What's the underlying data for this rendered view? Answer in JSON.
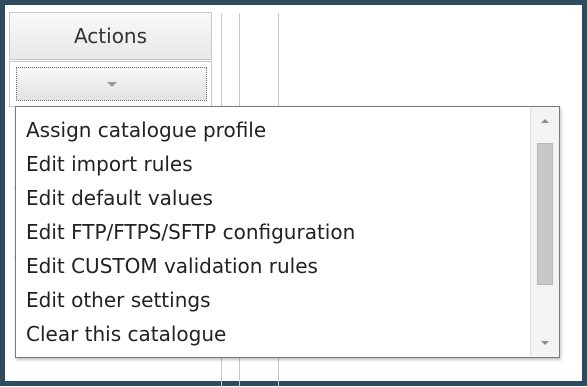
{
  "table": {
    "header_label": "Actions"
  },
  "actions_select": {
    "selected_value": "",
    "options": [
      {
        "label": "Assign catalogue profile"
      },
      {
        "label": "Edit import rules"
      },
      {
        "label": "Edit default values"
      },
      {
        "label": "Edit FTP/FTPS/SFTP configuration"
      },
      {
        "label": "Edit CUSTOM validation rules"
      },
      {
        "label": "Edit other settings"
      },
      {
        "label": "Clear this catalogue"
      }
    ]
  },
  "icons": {
    "select_arrow": "chevron-down-icon",
    "scroll_up": "scroll-up-arrow-icon",
    "scroll_down": "scroll-down-arrow-icon"
  },
  "colors": {
    "frame_border": "#2e4c5e",
    "grid_line": "#c8c8c8",
    "header_background": "#eeeeee"
  }
}
